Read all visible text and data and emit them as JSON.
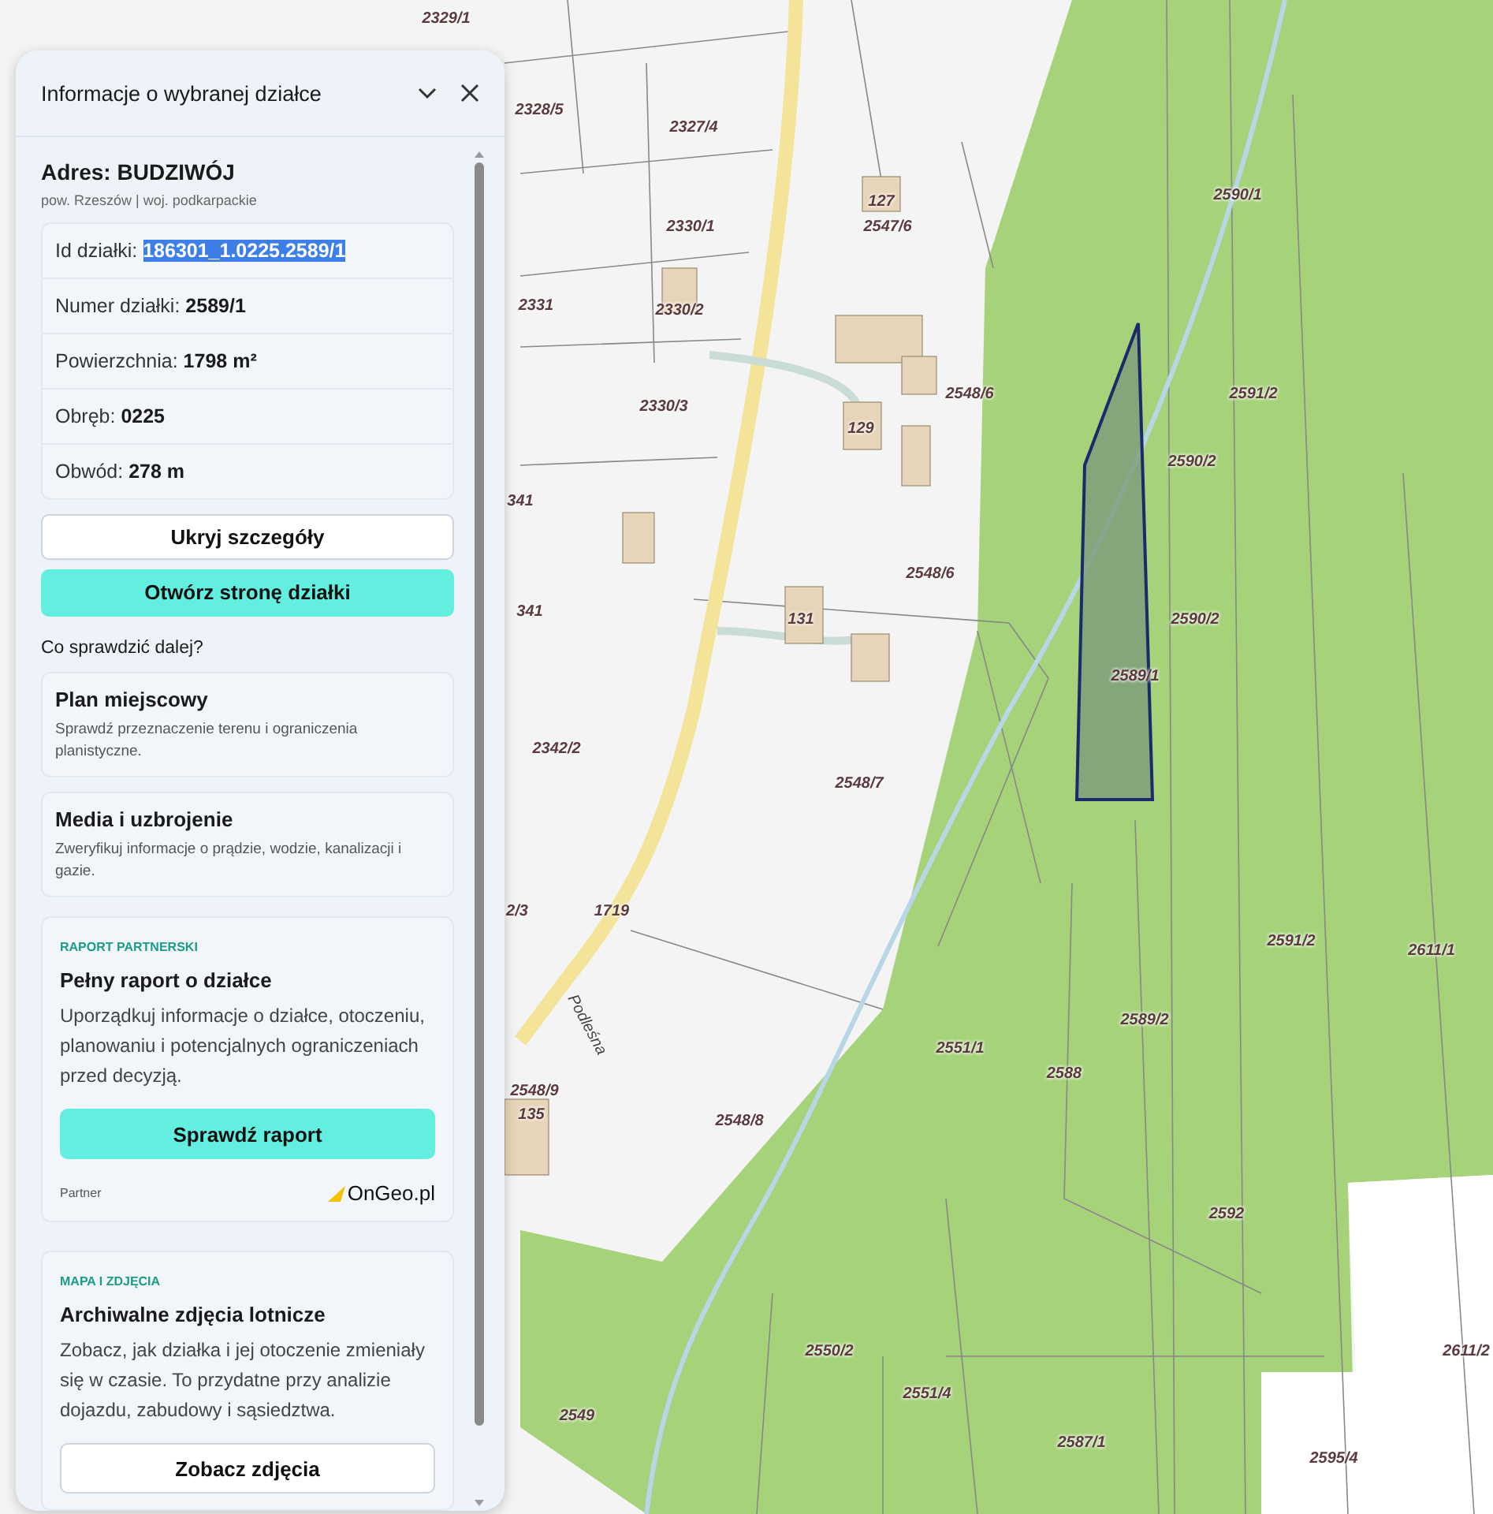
{
  "map": {
    "labels": [
      "2329/1",
      "2328/5",
      "2327/4",
      "2330/1",
      "127",
      "2547/6",
      "2590/1",
      "2331",
      "2330/2",
      "2591/2",
      "2548/6",
      "129",
      "2330/3",
      "2590/2",
      "341",
      "2548/6",
      "131",
      "2590/2",
      "341",
      "2589/1",
      "2342/2",
      "2548/7",
      "2591/2",
      "2611/1",
      "1719",
      "2/3",
      "2589/2",
      "2551/1",
      "2588",
      "2548/9",
      "135",
      "2548/8",
      "2592",
      "2550/2",
      "2551/4",
      "2611/2",
      "2549",
      "2587/1",
      "2595/4",
      "Podleśna"
    ]
  },
  "panel": {
    "title": "Informacje o wybranej działce",
    "address": {
      "title": "Adres: BUDZIWÓJ",
      "subtitle": "pow. Rzeszów | woj. podkarpackie"
    },
    "details": [
      {
        "label": "Id działki:",
        "value": "186301_1.0225.2589/1",
        "selected": true
      },
      {
        "label": "Numer działki:",
        "value": "2589/1",
        "selected": false
      },
      {
        "label": "Powierzchnia:",
        "value": "1798 m²",
        "selected": false
      },
      {
        "label": "Obręb:",
        "value": "0225",
        "selected": false
      },
      {
        "label": "Obwód:",
        "value": "278 m",
        "selected": false
      }
    ],
    "buttons": [
      {
        "label": "Ukryj szczegóły",
        "kind": "secondary"
      },
      {
        "label": "Otwórz stronę działki",
        "kind": "primary"
      }
    ],
    "next_heading": "Co sprawdzić dalej?",
    "cards": [
      {
        "kind": "link",
        "title": "Plan miejscowy",
        "text": "Sprawdź przeznaczenie terenu i ograniczenia planistyczne."
      },
      {
        "kind": "link",
        "title": "Media i uzbrojenie",
        "text": "Zweryfikuj informacje o prądzie, wodzie, kanalizacji i gazie."
      },
      {
        "kind": "promo",
        "eyebrow": "RAPORT PARTNERSKI",
        "title": "Pełny raport o działce",
        "text": "Uporządkuj informacje o działce, otoczeniu, planowaniu i potencjalnych ograniczeniach przed decyzją.",
        "button": {
          "label": "Sprawdź raport",
          "kind": "primary"
        },
        "partner_label": "Partner",
        "partner_logo": "OnGeo.pl"
      },
      {
        "kind": "promo",
        "eyebrow": "MAPA I ZDJĘCIA",
        "title": "Archiwalne zdjęcia lotnicze",
        "text": "Zobacz, jak działka i jej otoczenie zmieniały się w czasie. To przydatne przy analizie dojazdu, zabudowy i sąsiedztwa.",
        "button": {
          "label": "Zobacz zdjęcia",
          "kind": "secondary"
        }
      }
    ]
  }
}
